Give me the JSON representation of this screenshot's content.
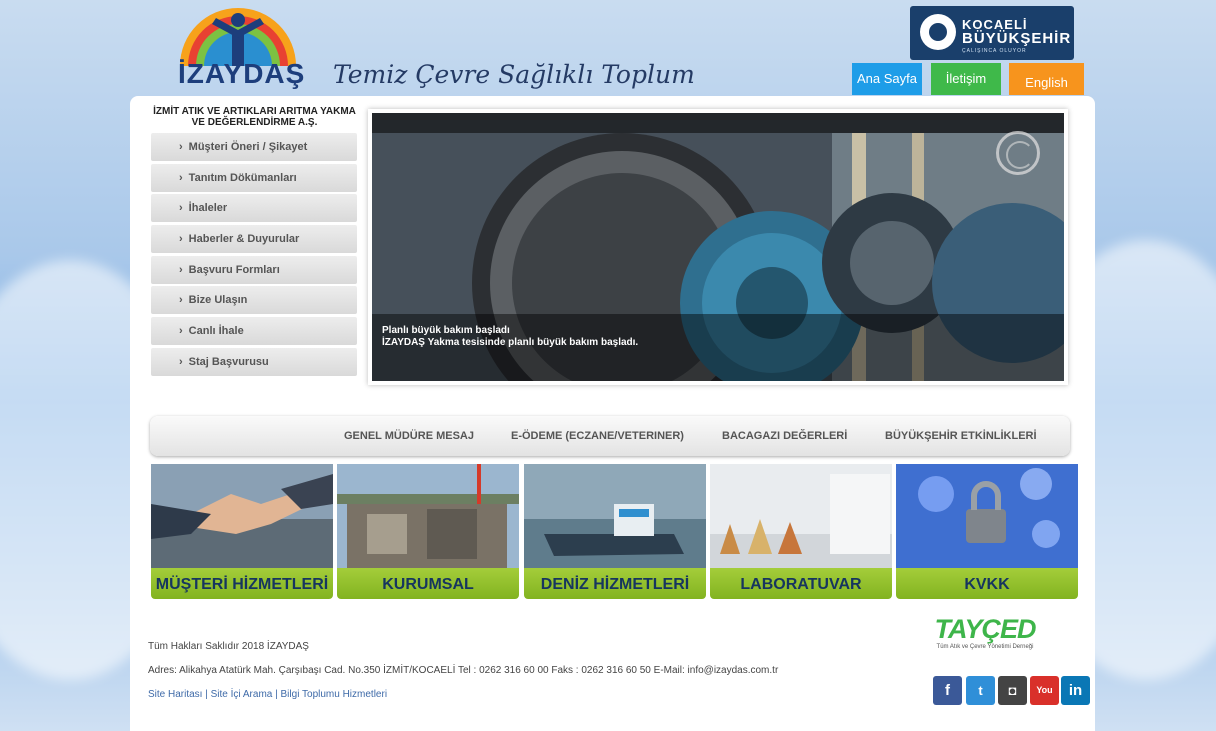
{
  "colors": {
    "brand_navy": "#1d3e7c",
    "btn_home": "#1e9de8",
    "btn_contact": "#3fb94a",
    "btn_english": "#f7941d",
    "tile_green": "#8cbd27"
  },
  "header": {
    "logo_text": "İZAYDAŞ",
    "slogan": "Temiz Çevre Sağlıklı Toplum",
    "partner_logo": {
      "line1": "KOCAELİ",
      "line2": "BÜYÜKŞEHİR",
      "line3": "ÇALIŞINCA OLUYOR"
    },
    "top_buttons": [
      {
        "label": "Ana Sayfa",
        "color": "#1e9de8"
      },
      {
        "label": "İletişim",
        "color": "#3fb94a"
      },
      {
        "label": "English",
        "color": "#f7941d"
      }
    ]
  },
  "sidebar": {
    "company": "İZMİT ATIK VE ARTIKLARI ARITMA YAKMA VE DEĞERLENDİRME A.Ş.",
    "items": [
      {
        "label": "Müşteri Öneri / Şikayet"
      },
      {
        "label": "Tanıtım Dökümanları"
      },
      {
        "label": "İhaleler"
      },
      {
        "label": "Haberler & Duyurular"
      },
      {
        "label": "Başvuru Formları"
      },
      {
        "label": "Bize Ulaşın"
      },
      {
        "label": "Canlı İhale"
      },
      {
        "label": "Staj Başvurusu"
      }
    ]
  },
  "slider": {
    "title": "Planlı büyük bakım başladı",
    "subtitle": "İZAYDAŞ Yakma tesisinde planlı büyük bakım başladı."
  },
  "quick_links": [
    "GENEL MÜDÜRE MESAJ",
    "E-ÖDEME (ECZANE/VETERINER)",
    "BACAGAZI DEĞERLERİ",
    "BÜYÜKŞEHİR ETKİNLİKLERİ"
  ],
  "tiles": [
    {
      "label": "MÜŞTERİ HİZMETLERİ"
    },
    {
      "label": "KURUMSAL"
    },
    {
      "label": "DENİZ HİZMETLERİ"
    },
    {
      "label": "LABORATUVAR"
    },
    {
      "label": "KVKK"
    }
  ],
  "footer": {
    "copyright": "Tüm Hakları Saklıdır 2018 İZAYDAŞ",
    "address": "Adres: Alikahya Atatürk Mah. Çarşıbaşı Cad. No.350 İZMİT/KOCAELİ Tel : 0262 316 60 00 Faks : 0262 316 60 50 E-Mail: info@izaydas.com.tr",
    "links": [
      "Site Haritası",
      "Site İçi Arama",
      "Bilgi Toplumu Hizmetleri"
    ],
    "separator": "|",
    "partner": {
      "name": "TAYÇED",
      "tagline": "Tüm Atık ve Çevre Yönetimi Derneği"
    },
    "social": [
      {
        "icon": "facebook-icon",
        "glyph": "f",
        "color": "#3b5998"
      },
      {
        "icon": "twitter-icon",
        "glyph": "t",
        "color": "#2f8fd8"
      },
      {
        "icon": "instagram-icon",
        "glyph": "◘",
        "color": "#444444"
      },
      {
        "icon": "youtube-icon",
        "glyph": "You",
        "color": "#d9302a"
      },
      {
        "icon": "linkedin-icon",
        "glyph": "in",
        "color": "#0a77b5"
      }
    ]
  }
}
